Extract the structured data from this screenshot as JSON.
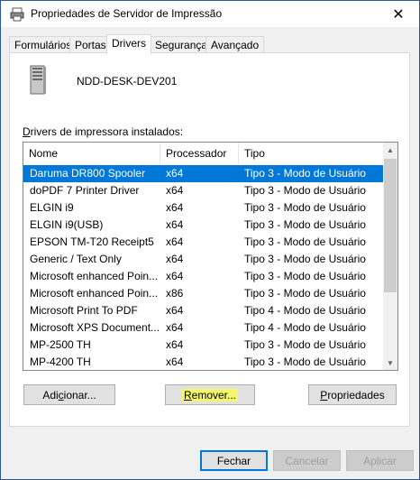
{
  "window": {
    "title": "Propriedades de Servidor de Impressão",
    "close_glyph": "✕"
  },
  "tabs": [
    {
      "label": "Formulários"
    },
    {
      "label": "Portas"
    },
    {
      "label": "Drivers"
    },
    {
      "label": "Segurança"
    },
    {
      "label": "Avançado"
    }
  ],
  "active_tab": "Drivers",
  "server": {
    "name": "NDD-DESK-DEV201"
  },
  "drivers_list": {
    "label": "Drivers de impressora instalados:",
    "columns": [
      "Nome",
      "Processador",
      "Tipo"
    ],
    "rows": [
      {
        "name": "Daruma DR800 Spooler",
        "processor": "x64",
        "type": "Tipo 3 - Modo de Usuário",
        "selected": true
      },
      {
        "name": "doPDF 7 Printer Driver",
        "processor": "x64",
        "type": "Tipo 3 - Modo de Usuário"
      },
      {
        "name": "ELGIN i9",
        "processor": "x64",
        "type": "Tipo 3 - Modo de Usuário"
      },
      {
        "name": "ELGIN i9(USB)",
        "processor": "x64",
        "type": "Tipo 3 - Modo de Usuário"
      },
      {
        "name": "EPSON TM-T20 Receipt5",
        "processor": "x64",
        "type": "Tipo 3 - Modo de Usuário"
      },
      {
        "name": "Generic / Text Only",
        "processor": "x64",
        "type": "Tipo 3 - Modo de Usuário"
      },
      {
        "name": "Microsoft enhanced Poin...",
        "processor": "x64",
        "type": "Tipo 3 - Modo de Usuário"
      },
      {
        "name": "Microsoft enhanced Poin...",
        "processor": "x86",
        "type": "Tipo 3 - Modo de Usuário"
      },
      {
        "name": "Microsoft Print To PDF",
        "processor": "x64",
        "type": "Tipo 4 - Modo de Usuário"
      },
      {
        "name": "Microsoft XPS Document...",
        "processor": "x64",
        "type": "Tipo 4 - Modo de Usuário"
      },
      {
        "name": "MP-2500 TH",
        "processor": "x64",
        "type": "Tipo 3 - Modo de Usuário"
      },
      {
        "name": "MP-4200 TH",
        "processor": "x64",
        "type": "Tipo 3 - Modo de Usuário"
      }
    ]
  },
  "actions": {
    "add": "Adicionar...",
    "remove": "Remover...",
    "properties": "Propriedades"
  },
  "footer": {
    "close": "Fechar",
    "cancel": "Cancelar",
    "apply": "Aplicar"
  },
  "colors": {
    "selection": "#0078d7",
    "highlight": "#f5f76b",
    "border_accent": "#2b579a"
  },
  "icons": {
    "app": "printer-server-icon",
    "server": "server-tower-icon"
  }
}
